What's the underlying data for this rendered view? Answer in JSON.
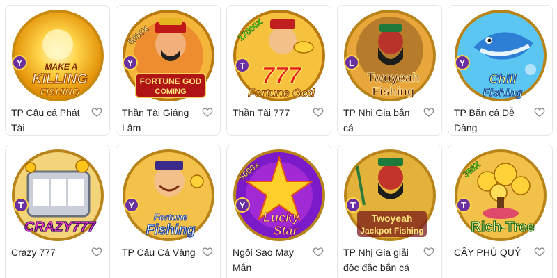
{
  "badges": {
    "multiplier_fortune_god": "5000X",
    "multiplier_than_tai": "17000X",
    "multiplier_lucky_star": "5000x",
    "multiplier_rich_tree": "388X",
    "provider_y": "Y",
    "provider_t": "T",
    "provider_l": "L"
  },
  "logos": {
    "make_a_killing": [
      "MAKE A",
      "KILLING",
      "FISHING"
    ],
    "fortune_god_coming": [
      "FORTUNE GOD",
      "COMING"
    ],
    "fortune_god": [
      "777",
      "Fortune God"
    ],
    "twoyeah_fishing": [
      "Twoyeah",
      "Fishing"
    ],
    "chill_fishing": [
      "Chill",
      "Fishing"
    ],
    "crazy777": "CRAZY777",
    "fortune_fishing": [
      "Fortune",
      "Fishing"
    ],
    "lucky_star": [
      "Lucky",
      "Star"
    ],
    "twoyeah_jackpot": [
      "Twoyeah",
      "Jackpot Fishing"
    ],
    "rich_tree": "Rich-Tree"
  },
  "games": [
    {
      "title": "TP Câu cá Phát Tài"
    },
    {
      "title": "Thần Tài Giáng Lâm"
    },
    {
      "title": "Thần Tài 777"
    },
    {
      "title": "TP Nhị Gia bắn cá"
    },
    {
      "title": "TP Bắn cá Dễ Dàng"
    },
    {
      "title": "Crazy 777"
    },
    {
      "title": "TP Câu Cá Vàng"
    },
    {
      "title": "Ngôi Sao May Mắn"
    },
    {
      "title": "TP Nhị Gia giải độc đắc bắn cá"
    },
    {
      "title": "CÂY PHÚ QUÝ"
    }
  ]
}
